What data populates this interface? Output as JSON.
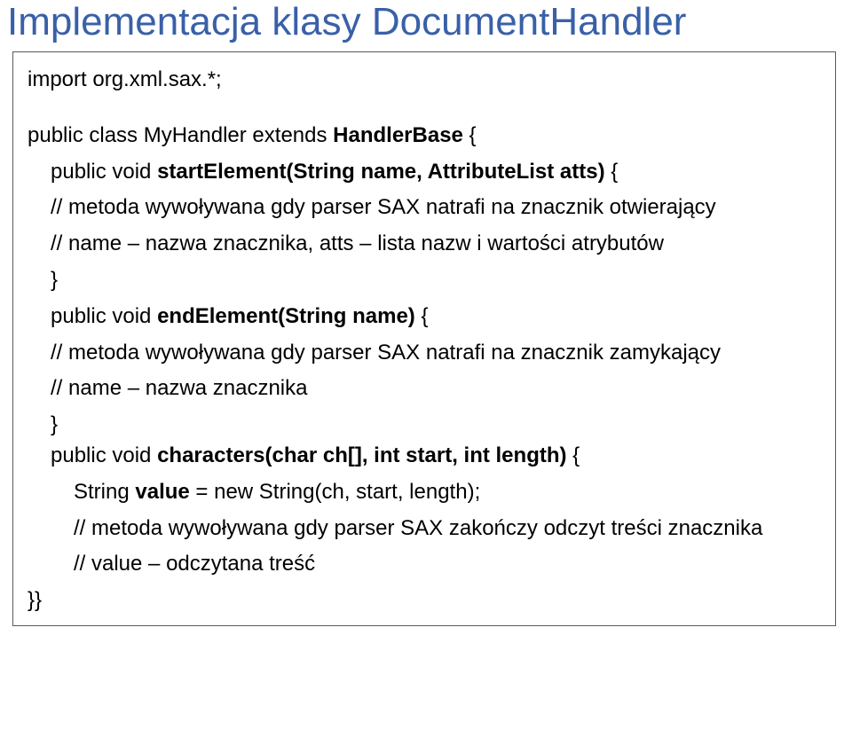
{
  "title": "Implementacja klasy DocumentHandler",
  "code": {
    "l00": "import org.xml.sax.*;",
    "l01a": "public class MyHandler extends ",
    "l01b": "HandlerBase",
    "l01c": " {",
    "l02a": "public void ",
    "l02b": "startElement(String name, AttributeList atts)",
    "l02c": " {",
    "l03": "// metoda wywoływana gdy parser SAX natrafi na znacznik otwierający",
    "l04": "// name – nazwa znacznika, atts – lista nazw i wartości atrybutów",
    "l05": "}",
    "l06a": "public void ",
    "l06b": "endElement(String name)",
    "l06c": " {",
    "l07": "// metoda wywoływana gdy parser SAX natrafi na znacznik zamykający",
    "l08": "// name – nazwa znacznika",
    "l09": "}",
    "l10a": "public void ",
    "l10b": "characters(char ch[], int start, int length)",
    "l10c": " {",
    "l11a": "String ",
    "l11b": "value",
    "l11c": " = new String(ch, start, length);",
    "l12": "// metoda wywoływana gdy parser SAX zakończy odczyt treści znacznika",
    "l13": "// value – odczytana treść",
    "l14": "}}"
  }
}
